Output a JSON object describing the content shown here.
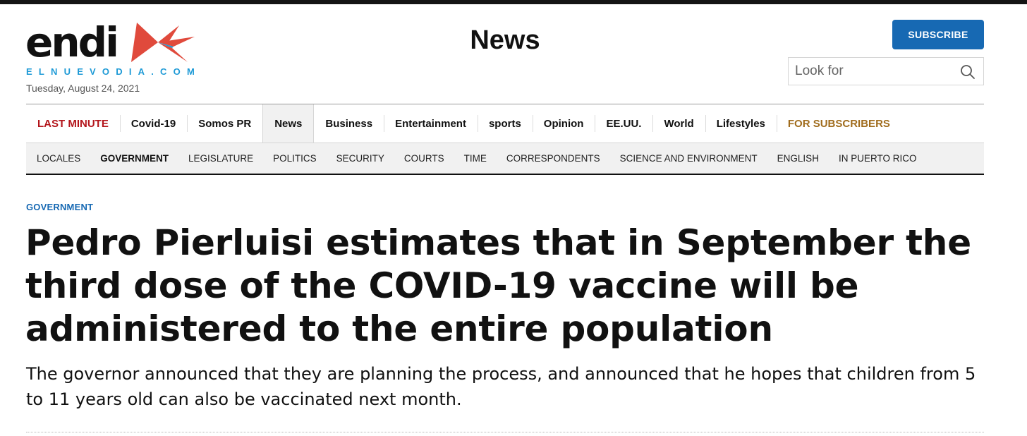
{
  "brand": {
    "logo_word": "endi",
    "logo_sub": "ELNUEVODIA.COM",
    "date": "Tuesday, August 24, 2021",
    "colors": {
      "logo_red": "#e04a3c",
      "logo_blue": "#1e9ad6",
      "accent_blue": "#1769b3",
      "breaking_red": "#b3151b",
      "subscribers_gold": "#a06c1d"
    }
  },
  "header": {
    "section_title": "News",
    "subscribe_label": "SUBSCRIBE",
    "search": {
      "placeholder": "Look for",
      "icon": "search-icon"
    }
  },
  "main_nav": {
    "items": [
      {
        "label": "LAST MINUTE"
      },
      {
        "label": "Covid-19"
      },
      {
        "label": "Somos PR"
      },
      {
        "label": "News",
        "active": true
      },
      {
        "label": "Business"
      },
      {
        "label": "Entertainment"
      },
      {
        "label": "sports"
      },
      {
        "label": "Opinion"
      },
      {
        "label": "EE.UU."
      },
      {
        "label": "World"
      },
      {
        "label": "Lifestyles"
      },
      {
        "label": "FOR SUBSCRIBERS"
      }
    ]
  },
  "sub_nav": {
    "items": [
      {
        "label": "LOCALES"
      },
      {
        "label": "GOVERNMENT",
        "active": true
      },
      {
        "label": "LEGISLATURE"
      },
      {
        "label": "POLITICS"
      },
      {
        "label": "SECURITY"
      },
      {
        "label": "COURTS"
      },
      {
        "label": "TIME"
      },
      {
        "label": "CORRESPONDENTS"
      },
      {
        "label": "SCIENCE AND ENVIRONMENT"
      },
      {
        "label": "ENGLISH"
      },
      {
        "label": "IN PUERTO RICO"
      }
    ]
  },
  "article": {
    "kicker": "GOVERNMENT",
    "headline": "Pedro Pierluisi estimates that in September the third dose of the COVID-19 vaccine will be administered to the entire population",
    "dek": "The governor announced that they are planning the process, and announced that he hopes that children from 5 to 11 years old can also be vaccinated next month."
  }
}
